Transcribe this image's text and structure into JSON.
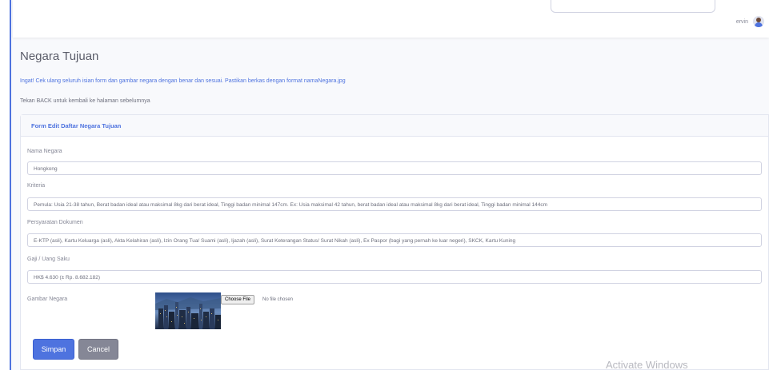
{
  "topbar": {
    "user_name": "ervin"
  },
  "page": {
    "title": "Negara Tujuan",
    "notice": "Ingat! Cek ulang seluruh isian form dan gambar negara dengan benar dan sesuai. Pastikan berkas dengan format namaNegara.jpg",
    "back_text": "Tekan BACK untuk kembali ke halaman sebelumnya"
  },
  "form": {
    "header": "Form Edit Daftar Negara Tujuan",
    "nama_negara": {
      "label": "Nama Negara",
      "value": "Hongkong"
    },
    "kriteria": {
      "label": "Kriteria",
      "value": "Pemula: Usia 21-38 tahun, Berat badan ideal atau maksimal 8kg dari berat ideal, Tinggi badan minimal 147cm. Ex: Usia maksimal 42 tahun, berat badan ideal atau maksimal 8kg dari berat ideal, Tinggi badan minimal 144cm"
    },
    "dokumen": {
      "label": "Persyaratan Dokumen",
      "value": "E-KTP (asli), Kartu Keluarga (asli), Akta Kelahiran (asli), Izin Orang Tua/ Suami (asli), Ijazah (asli), Surat Keterangan Status/ Surat Nikah (asli), Ex Paspor (bagi yang pernah ke luar negeri), SKCK, Kartu Kuning"
    },
    "gaji": {
      "label": "Gaji / Uang Saku",
      "value": "HK$ 4.630 (± Rp. 8.682.182)"
    },
    "gambar": {
      "label": "Gambar Negara",
      "file_button": "Choose File",
      "file_status": "No file chosen"
    },
    "save_label": "Simpan",
    "cancel_label": "Cancel"
  },
  "watermark": "Activate Windows",
  "colors": {
    "primary": "#4e73df",
    "secondary": "#858796"
  }
}
